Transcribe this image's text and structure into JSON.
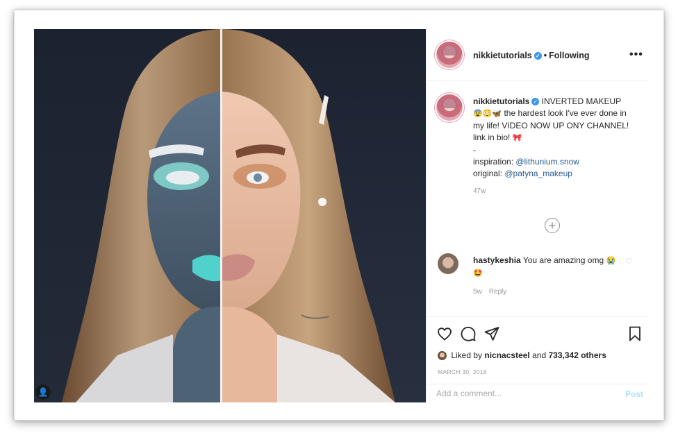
{
  "post": {
    "username": "nikkietutorials",
    "follow_status": "Following",
    "separator": "•",
    "more_glyph": "•••",
    "verified_glyph": "✓"
  },
  "caption": {
    "username": "nikkietutorials",
    "text_1": "INVERTED MAKEUP",
    "emojis": "😨😳🦋",
    "text_2": "the hardest look I've ever done in my life! VIDEO NOW UP ONY CHANNEL! link in bio!",
    "emoji_end": "🎀",
    "dash": "-",
    "inspiration_label": "inspiration:",
    "inspiration_handle": "@lithunium.snow",
    "original_label": "original:",
    "original_handle": "@patyna_makeup",
    "time_ago": "47w"
  },
  "load_more_glyph": "+",
  "comment": {
    "username": "hastykeshia",
    "text": "You are amazing omg",
    "emojis": "😭🤩",
    "time": "5w",
    "reply_label": "Reply"
  },
  "actions": {
    "icons": [
      "heart-icon",
      "comment-icon",
      "share-icon",
      "bookmark-icon"
    ]
  },
  "likes": {
    "prefix": "Liked by",
    "liker": "nicnacsteel",
    "middle": "and",
    "count": "733,342 others"
  },
  "post_date": "MARCH 30, 2018",
  "add_comment": {
    "placeholder": "Add a comment...",
    "post_label": "Post"
  },
  "colors": {
    "accent_blue": "#3897f0",
    "mention_blue": "#2a5c8f",
    "post_button_disabled": "#b2dffc",
    "photo_background": "#1e2633"
  }
}
